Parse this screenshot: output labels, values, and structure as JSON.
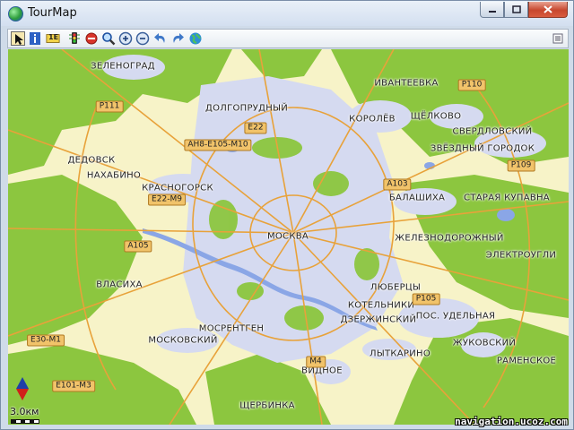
{
  "window": {
    "title": "TourMap"
  },
  "toolbar": {
    "items": [
      {
        "name": "select-arrow-icon"
      },
      {
        "name": "info-icon"
      },
      {
        "name": "measure-icon"
      },
      {
        "name": "traffic-light-icon"
      },
      {
        "name": "route-icon"
      },
      {
        "name": "stop-icon"
      },
      {
        "name": "search-icon"
      },
      {
        "name": "zoom-in-icon"
      },
      {
        "name": "zoom-out-icon"
      },
      {
        "name": "undo-icon"
      },
      {
        "name": "redo-icon"
      },
      {
        "name": "globe-icon"
      },
      {
        "name": "menu-list-icon"
      }
    ],
    "measure_label": "1E"
  },
  "map": {
    "places": [
      {
        "id": "zelenograd",
        "text": "ЗЕЛЕНОГРАД"
      },
      {
        "id": "dolgoprudny",
        "text": "ДОЛГОПРУДНЫЙ"
      },
      {
        "id": "ivanteevka",
        "text": "ИВАНТЕЕВКА"
      },
      {
        "id": "korolev",
        "text": "КОРОЛЁВ"
      },
      {
        "id": "shchelkovo",
        "text": "ЩЁЛКОВО"
      },
      {
        "id": "sverdlovsky",
        "text": "СВЕРДЛОВСКИЙ"
      },
      {
        "id": "zvezdny",
        "text": "ЗВЁЗДНЫЙ ГОРОДОК"
      },
      {
        "id": "dedovsk",
        "text": "ДЕДОВСК"
      },
      {
        "id": "nakhabino",
        "text": "НАХАБИНО"
      },
      {
        "id": "krasnogorsk",
        "text": "КРАСНОГОРСК"
      },
      {
        "id": "balashikha",
        "text": "БАЛАШИХА"
      },
      {
        "id": "kupavna",
        "text": "СТАРАЯ КУПАВНА"
      },
      {
        "id": "moskva",
        "text": "МОСКВА"
      },
      {
        "id": "zheleznodorozhny",
        "text": "ЖЕЛЕЗНОДОРОЖНЫЙ"
      },
      {
        "id": "elektrougli",
        "text": "ЭЛЕКТРОУГЛИ"
      },
      {
        "id": "vlasikha",
        "text": "ВЛАСИХА"
      },
      {
        "id": "lyubertsy",
        "text": "ЛЮБЕРЦЫ"
      },
      {
        "id": "kotelniki",
        "text": "КОТЕЛЬНИКИ"
      },
      {
        "id": "dzerzhinsky",
        "text": "ДЗЕРЖИНСКИЙ"
      },
      {
        "id": "udelnaya",
        "text": "ПОС. УДЕЛЬНАЯ"
      },
      {
        "id": "mosrentgen",
        "text": "МОСРЕНТГЕН"
      },
      {
        "id": "moskovsky",
        "text": "МОСКОВСКИЙ"
      },
      {
        "id": "zhukovsky",
        "text": "ЖУКОВСКИЙ"
      },
      {
        "id": "lytkarino",
        "text": "ЛЫТКАРИНО"
      },
      {
        "id": "vidnoe",
        "text": "ВИДНОЕ"
      },
      {
        "id": "ramenskoe",
        "text": "РАМЕНСКОЕ"
      },
      {
        "id": "shcherbinka",
        "text": "ЩЕРБИНКА"
      }
    ],
    "roads": [
      {
        "id": "p111",
        "text": "P111"
      },
      {
        "id": "p110",
        "text": "P110"
      },
      {
        "id": "e22",
        "text": "E22"
      },
      {
        "id": "ah8",
        "text": "AH8-E105-M10"
      },
      {
        "id": "p109",
        "text": "P109"
      },
      {
        "id": "a103",
        "text": "A103"
      },
      {
        "id": "e22m9",
        "text": "E22-M9"
      },
      {
        "id": "a105",
        "text": "A105"
      },
      {
        "id": "p105",
        "text": "P105"
      },
      {
        "id": "e30m1",
        "text": "E30-M1"
      },
      {
        "id": "m4",
        "text": "M4"
      },
      {
        "id": "e101m3",
        "text": "E101-M3"
      }
    ],
    "scale": "3.0км",
    "watermark": "navigation.ucoz.com",
    "colors": {
      "forest": "#8cc63f",
      "urban": "#d5daf0",
      "open": "#f7f3c8",
      "road": "#e8a23a",
      "water": "#8aa6e6"
    }
  }
}
